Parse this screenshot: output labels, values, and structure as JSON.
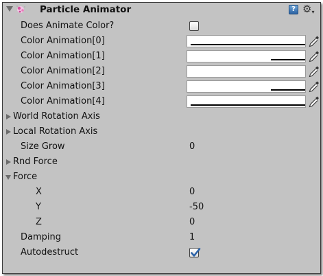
{
  "component": {
    "title": "Particle Animator",
    "help_icon_text": "?",
    "icons": {
      "component": "particle-sparkle-icon",
      "help": "help-book-icon",
      "settings": "gear-icon"
    }
  },
  "properties": {
    "does_animate_color": {
      "label": "Does Animate Color?",
      "checked": false
    },
    "color_animation": [
      {
        "label": "Color Animation[0]",
        "color": "#ffffff",
        "alpha": 0.97
      },
      {
        "label": "Color Animation[1]",
        "color": "#ffffff",
        "alpha": 0.29
      },
      {
        "label": "Color Animation[2]",
        "color": "#ffffff",
        "alpha": 0.0
      },
      {
        "label": "Color Animation[3]",
        "color": "#ffffff",
        "alpha": 0.29
      },
      {
        "label": "Color Animation[4]",
        "color": "#ffffff",
        "alpha": 0.97
      }
    ],
    "world_rotation_axis": {
      "label": "World Rotation Axis",
      "expanded": false
    },
    "local_rotation_axis": {
      "label": "Local Rotation Axis",
      "expanded": false
    },
    "size_grow": {
      "label": "Size Grow",
      "value": "0"
    },
    "rnd_force": {
      "label": "Rnd Force",
      "expanded": false
    },
    "force": {
      "label": "Force",
      "expanded": true,
      "x": {
        "label": "X",
        "value": "0"
      },
      "y": {
        "label": "Y",
        "value": "-50"
      },
      "z": {
        "label": "Z",
        "value": "0"
      }
    },
    "damping": {
      "label": "Damping",
      "value": "1"
    },
    "autodestruct": {
      "label": "Autodestruct",
      "checked": true
    }
  },
  "colors": {
    "panel_bg": "#c3c3c3",
    "fold_arrow": "#6c6c6c",
    "checkmark": "#2a62a8"
  }
}
